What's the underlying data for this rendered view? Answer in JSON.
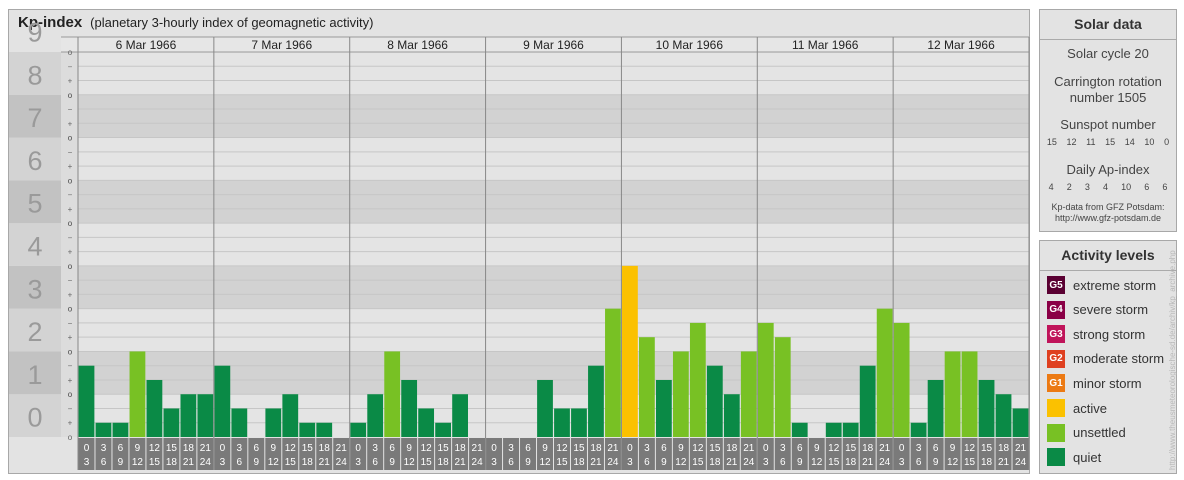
{
  "header": {
    "title": "Kp-index",
    "subtitle": "(planetary 3-hourly index of geomagnetic activity)"
  },
  "chart_data": {
    "type": "bar",
    "title": "Kp-index",
    "subtitle": "(planetary 3-hourly index of geomagnetic activity)",
    "ylim": [
      0,
      9
    ],
    "y_ticks": [
      "0",
      "1",
      "2",
      "3",
      "4",
      "5",
      "6",
      "7",
      "8",
      "9"
    ],
    "sub_tick_labels": [
      "o",
      "+",
      "−",
      "o"
    ],
    "days": [
      "6 Mar 1966",
      "7 Mar 1966",
      "8 Mar 1966",
      "9 Mar 1966",
      "10 Mar 1966",
      "11 Mar 1966",
      "12 Mar 1966"
    ],
    "interval_top": [
      "0",
      "3",
      "6",
      "9",
      "12",
      "15",
      "18",
      "21"
    ],
    "interval_bottom": [
      "3",
      "6",
      "9",
      "12",
      "15",
      "18",
      "21",
      "24"
    ],
    "values": [
      [
        1.667,
        0.333,
        0.333,
        2.0,
        1.333,
        0.667,
        1.0,
        1.0
      ],
      [
        1.667,
        0.667,
        0.0,
        0.667,
        1.0,
        0.333,
        0.333,
        0.0
      ],
      [
        0.333,
        1.0,
        2.0,
        1.333,
        0.667,
        0.333,
        1.0,
        0.0
      ],
      [
        0.0,
        0.0,
        0.0,
        1.333,
        0.667,
        0.667,
        1.667,
        3.0
      ],
      [
        4.0,
        2.333,
        1.333,
        2.0,
        2.667,
        1.667,
        1.0,
        2.0
      ],
      [
        2.667,
        2.333,
        0.333,
        0.0,
        0.333,
        0.333,
        1.667,
        3.0
      ],
      [
        2.667,
        0.333,
        1.333,
        2.0,
        2.0,
        1.333,
        1.0,
        0.667
      ]
    ],
    "grid": true,
    "colors": {
      "quiet": "#0a8a46",
      "unsettled": "#78c124",
      "active": "#fbc100"
    }
  },
  "solar": {
    "heading": "Solar data",
    "cycle": "Solar cycle 20",
    "carrington_1": "Carrington rotation",
    "carrington_2": "number 1505",
    "sunspot_label": "Sunspot number",
    "sunspot_values": [
      "15",
      "12",
      "11",
      "15",
      "14",
      "10",
      "0"
    ],
    "ap_label": "Daily Ap-index",
    "ap_values": [
      "4",
      "2",
      "3",
      "4",
      "10",
      "6",
      "6"
    ],
    "source_1": "Kp-data from GFZ Potsdam:",
    "source_2": "http://www.gfz-potsdam.de"
  },
  "activity": {
    "heading": "Activity levels",
    "items": [
      {
        "badge": "G5",
        "label": "extreme storm",
        "color": "#5a0032"
      },
      {
        "badge": "G4",
        "label": "severe storm",
        "color": "#8a0046"
      },
      {
        "badge": "G3",
        "label": "strong storm",
        "color": "#c0145a"
      },
      {
        "badge": "G2",
        "label": "moderate storm",
        "color": "#df4020"
      },
      {
        "badge": "G1",
        "label": "minor storm",
        "color": "#ec7a14"
      },
      {
        "badge": "",
        "label": "active",
        "color": "#fbc100"
      },
      {
        "badge": "",
        "label": "unsettled",
        "color": "#78c124"
      },
      {
        "badge": "",
        "label": "quiet",
        "color": "#0a8a46"
      }
    ]
  },
  "watermark": "http://www.theusmeteorologische-sd.de/archiv/kp_archive.php"
}
